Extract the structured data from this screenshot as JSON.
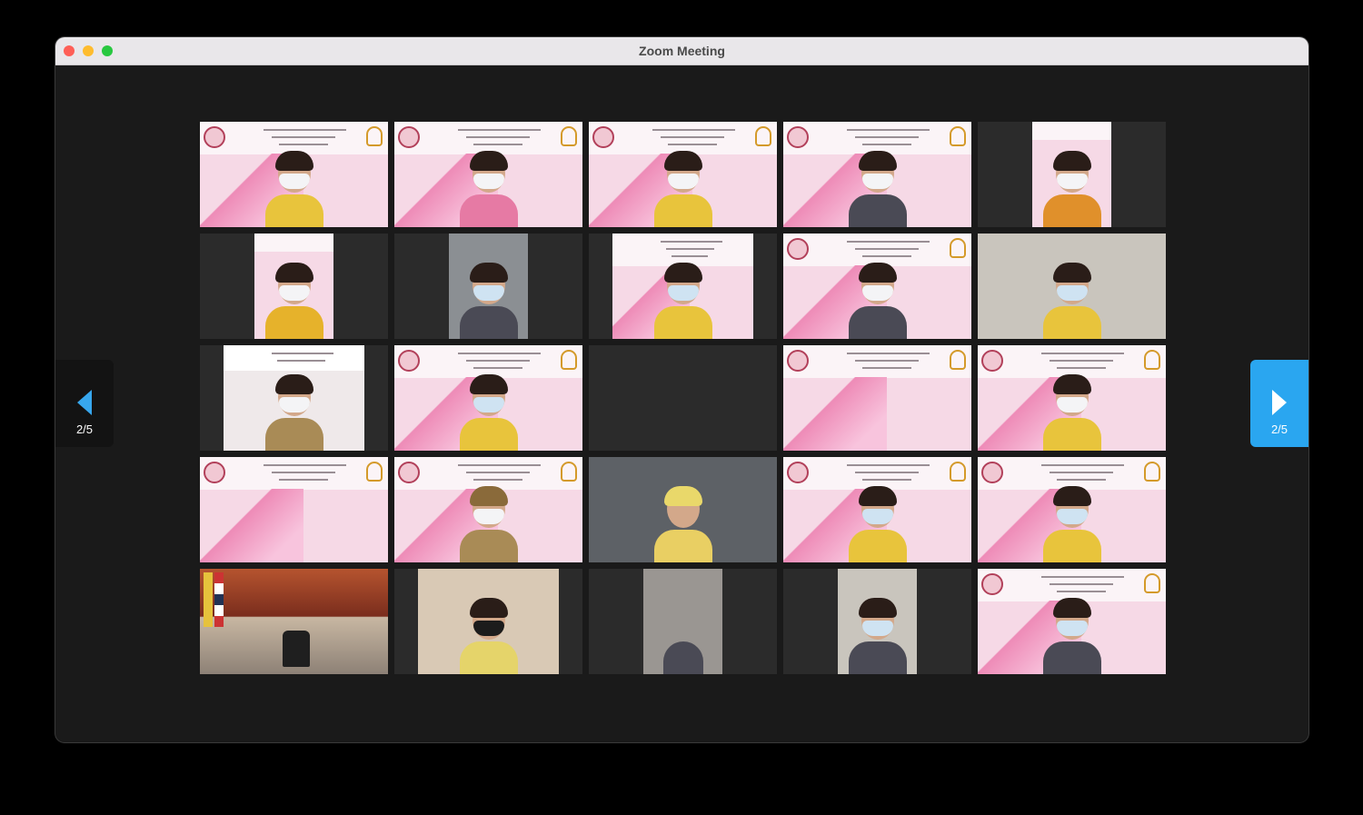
{
  "window": {
    "title": "Zoom Meeting"
  },
  "pagination": {
    "prev_label": "2/5",
    "next_label": "2/5"
  },
  "colors": {
    "accent": "#2aa6f0",
    "background": "#1a1a1a",
    "banner_pink": "#f6d9e6"
  },
  "participants": [
    {
      "tile": 1,
      "kind": "banner-full"
    },
    {
      "tile": 2,
      "kind": "banner-full"
    },
    {
      "tile": 3,
      "kind": "banner-full"
    },
    {
      "tile": 4,
      "kind": "banner-full"
    },
    {
      "tile": 5,
      "kind": "portrait-narrow"
    },
    {
      "tile": 6,
      "kind": "portrait-narrow"
    },
    {
      "tile": 7,
      "kind": "portrait-narrow-office"
    },
    {
      "tile": 8,
      "kind": "portrait-wide-banner"
    },
    {
      "tile": 9,
      "kind": "banner-full"
    },
    {
      "tile": 10,
      "kind": "office-full"
    },
    {
      "tile": 11,
      "kind": "portrait-wide"
    },
    {
      "tile": 12,
      "kind": "banner-full"
    },
    {
      "tile": 13,
      "kind": "empty"
    },
    {
      "tile": 14,
      "kind": "banner-full"
    },
    {
      "tile": 15,
      "kind": "banner-full"
    },
    {
      "tile": 16,
      "kind": "banner-full"
    },
    {
      "tile": 17,
      "kind": "banner-full"
    },
    {
      "tile": 18,
      "kind": "office-full"
    },
    {
      "tile": 19,
      "kind": "banner-full"
    },
    {
      "tile": 20,
      "kind": "banner-full"
    },
    {
      "tile": 21,
      "kind": "stage-full"
    },
    {
      "tile": 22,
      "kind": "portrait-wide"
    },
    {
      "tile": 23,
      "kind": "portrait-narrow-office"
    },
    {
      "tile": 24,
      "kind": "portrait-narrow-office"
    },
    {
      "tile": 25,
      "kind": "banner-full"
    }
  ]
}
